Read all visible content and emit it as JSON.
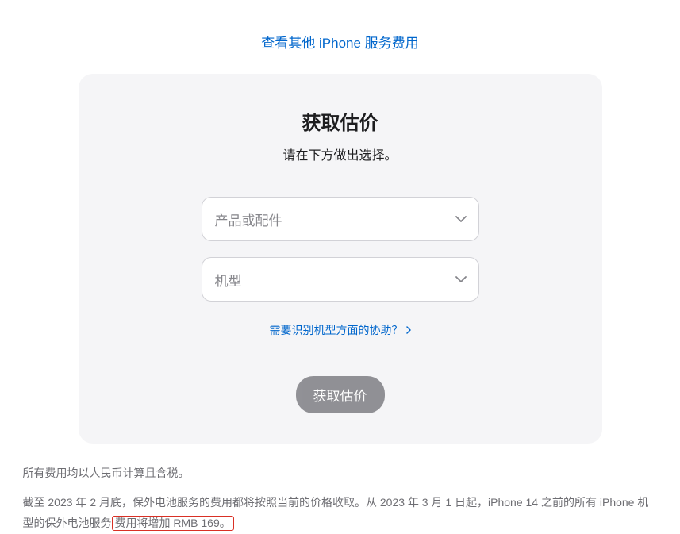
{
  "topLink": {
    "text": "查看其他 iPhone 服务费用"
  },
  "card": {
    "title": "获取估价",
    "subtitle": "请在下方做出选择。",
    "productSelect": {
      "placeholder": "产品或配件"
    },
    "modelSelect": {
      "placeholder": "机型"
    },
    "helpLink": {
      "text": "需要识别机型方面的协助？"
    },
    "submitButton": {
      "label": "获取估价"
    }
  },
  "footer": {
    "line1": "所有费用均以人民币计算且含税。",
    "line2_part1": "截至 2023 年 2 月底，保外电池服务的费用都将按照当前的价格收取。从 2023 年 3 月 1 日起，iPhone 14 之前的所有 iPhone 机型的保外电池服务",
    "line2_highlight": "费用将增加 RMB 169。"
  }
}
